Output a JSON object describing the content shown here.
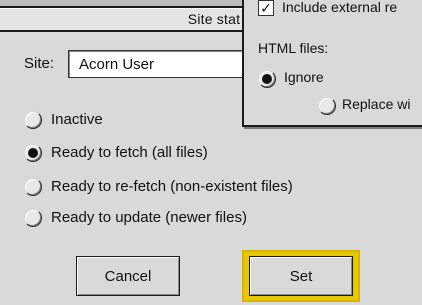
{
  "site_status_window": {
    "title": "Site stat",
    "site_label": "Site:",
    "site_value": "Acorn User",
    "status_options": [
      {
        "label": "Inactive",
        "selected": false
      },
      {
        "label": "Ready to fetch (all files)",
        "selected": true
      },
      {
        "label": "Ready to re-fetch (non-existent files)",
        "selected": false
      },
      {
        "label": "Ready to update (newer files)",
        "selected": false
      }
    ],
    "cancel_label": "Cancel",
    "set_label": "Set",
    "default_button_color": "#e8c800"
  },
  "options_window": {
    "include_external_label": "Include external re",
    "include_external_checked": true,
    "check_glyph": "✓",
    "html_files_label": "HTML files:",
    "ignore_label": "Ignore",
    "ignore_selected": true,
    "replace_label": "Replace wi",
    "replace_selected": false
  }
}
